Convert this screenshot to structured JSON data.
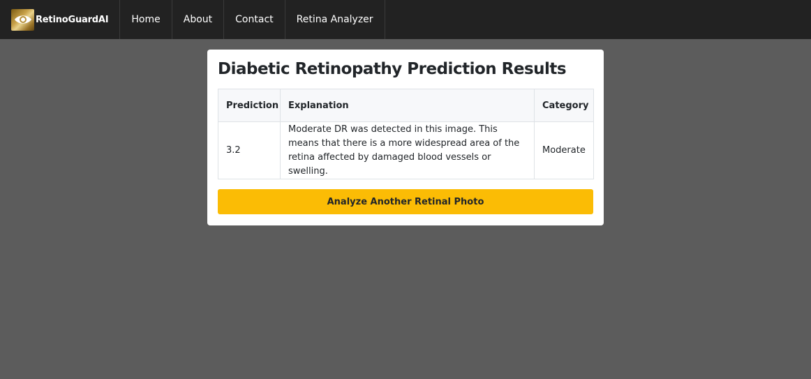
{
  "navbar": {
    "brand": "RetinoGuardAI",
    "links": [
      {
        "label": "Home"
      },
      {
        "label": "About"
      },
      {
        "label": "Contact"
      },
      {
        "label": "Retina Analyzer"
      }
    ]
  },
  "results": {
    "title": "Diabetic Retinopathy Prediction Results",
    "table": {
      "headers": [
        "Prediction",
        "Explanation",
        "Category"
      ],
      "rows": [
        {
          "prediction": "3.2",
          "explanation": "Moderate DR was detected in this image. This means that there is a more widespread area of the retina affected by damaged blood vessels or swelling.",
          "category": "Moderate"
        }
      ]
    },
    "button_label": "Analyze Another Retinal Photo"
  },
  "colors": {
    "navbar_bg": "#222222",
    "page_bg": "#5c5c5c",
    "button_bg": "#fbbc05",
    "brand_gold": "#c9a24a"
  }
}
